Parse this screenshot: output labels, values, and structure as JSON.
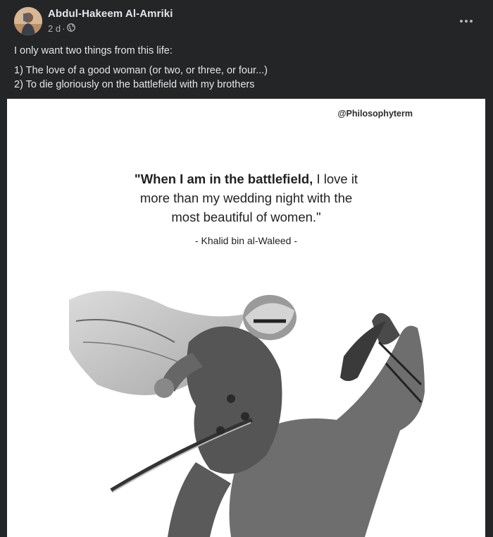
{
  "post": {
    "author": "Abdul-Hakeem Al-Amriki",
    "time": "2 d",
    "separator": "·",
    "privacy_icon": "globe-icon",
    "more_icon": "more-dots-icon",
    "text": {
      "intro": "I only want two things from this life:",
      "line1": "1) The love of a good woman (or two, or three, or four...)",
      "line2": "2) To die gloriously on the battlefield with my brothers"
    }
  },
  "image": {
    "handle": "@Philosophyterm",
    "quote_bold": "\"When I am in the battlefield,",
    "quote_rest1": " I love it",
    "quote_line2": "more than my wedding night with the",
    "quote_line3": "most beautiful of women.\"",
    "attribution": "- Khalid bin al-Waleed -",
    "illustration": "warrior-on-horse-sketch"
  },
  "colors": {
    "card_bg": "#242526",
    "text_primary": "#e4e6eb",
    "text_secondary": "#b0b3b8",
    "image_bg": "#ffffff"
  }
}
